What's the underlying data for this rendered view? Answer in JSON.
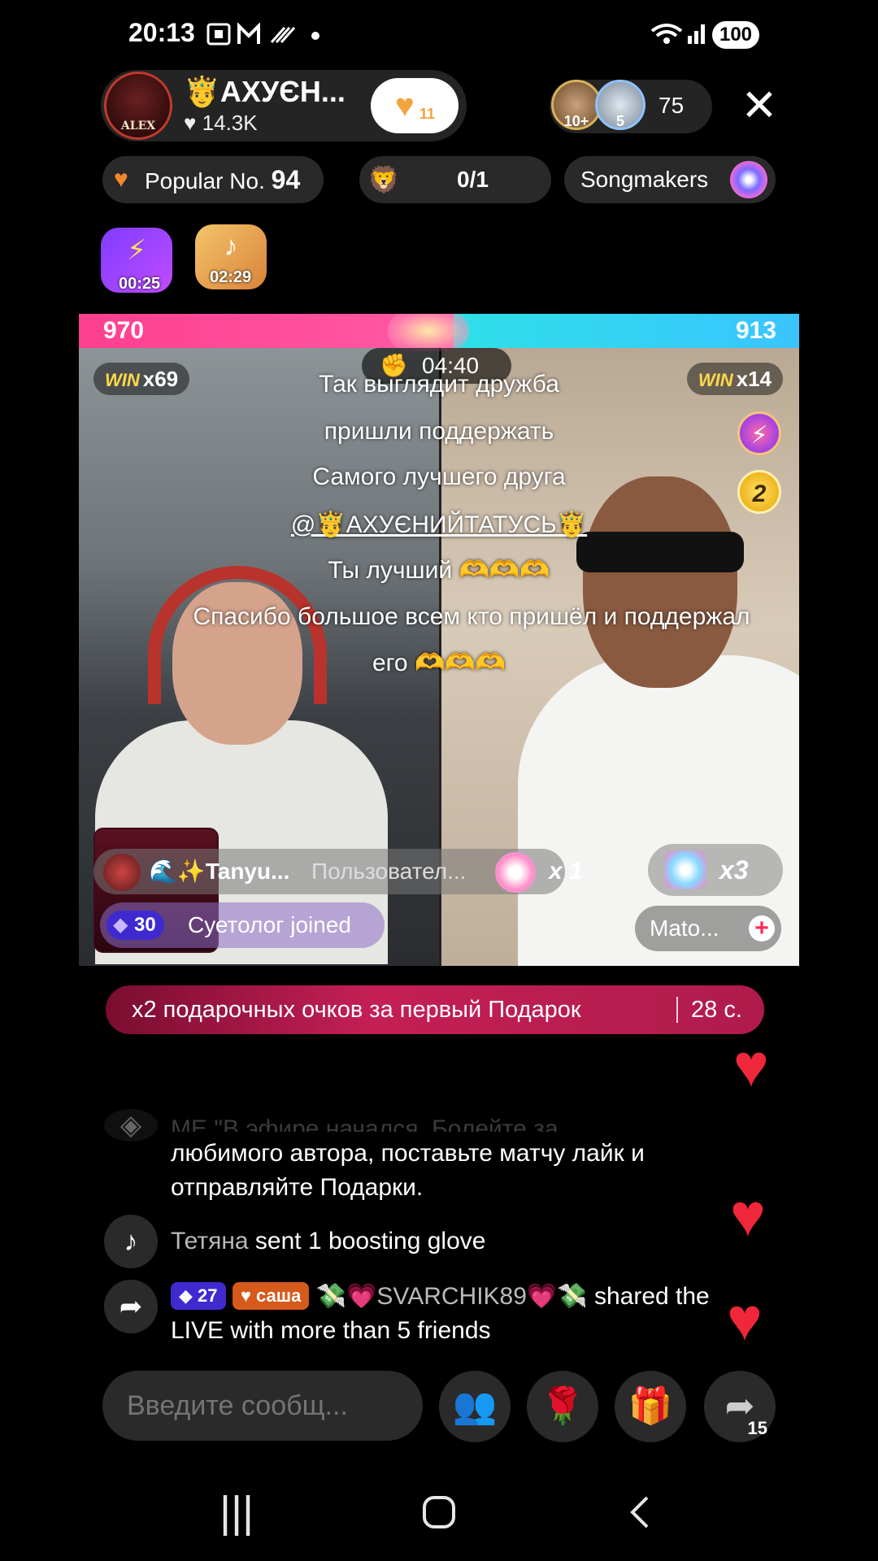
{
  "status": {
    "time": "20:13",
    "battery": "100"
  },
  "host": {
    "name": "🤴АХУЄН...",
    "likes": "♥ 14.3K",
    "avatar_label": "ALEX",
    "follow_count": "11"
  },
  "viewers": {
    "badge1": "10+",
    "badge2": "5",
    "count": "75"
  },
  "chips": {
    "popular_label": "Popular No.",
    "popular_rank": "94",
    "team": "0/1",
    "songmakers": "Songmakers"
  },
  "boxes": [
    {
      "timer": "00:25"
    },
    {
      "timer": "02:29"
    }
  ],
  "battle": {
    "score_left": "970",
    "score_right": "913",
    "timer": "04:40",
    "win_left_label": "WIN",
    "win_left_count": "x69",
    "win_right_label": "WIN",
    "win_right_count": "x14",
    "rank_badge": "2",
    "captions": [
      "Так выглядит дружба",
      "пришли поддержать",
      "Самого лучшего друга",
      "@🤴АХУЄНИЙТАТУСЬ🤴",
      "Ты лучший 🫶🫶🫶",
      "Спасибо большое всем кто пришёл и поддержал",
      "его 🫶🫶🫶"
    ],
    "gift_user": "🌊✨Tanyu...",
    "gift_text": "Пользовател...",
    "gift_mult": "x 1",
    "join_level": "30",
    "join_text": "Суетолог joined",
    "combo": "x3",
    "opponent_name": "Mato..."
  },
  "promo": {
    "text": "x2 подарочных очков за первый Подарок",
    "timer": "28 с."
  },
  "chat": {
    "faded_line": "МЕ \"В эфире начался. Болейте за",
    "system_message": "любимого автора, поставьте матчу лайк и отправляйте Подарки.",
    "items": [
      {
        "icon": "tiktok-icon",
        "name": "Тетяна",
        "text": " sent 1 boosting glove"
      },
      {
        "icon": "share-icon",
        "badge_level": "27",
        "badge_fan": "саша",
        "name": "💸💗SVARCHIK89💗💸",
        "text": " shared the LIVE with more than 5 friends"
      }
    ]
  },
  "composer": {
    "placeholder": "Введите сообщ...",
    "share_count": "15"
  },
  "colors": {
    "accent": "#fe2c55",
    "score_left": "#ff3f8f",
    "score_right": "#2ee0e8",
    "promo": "#c41f55"
  }
}
